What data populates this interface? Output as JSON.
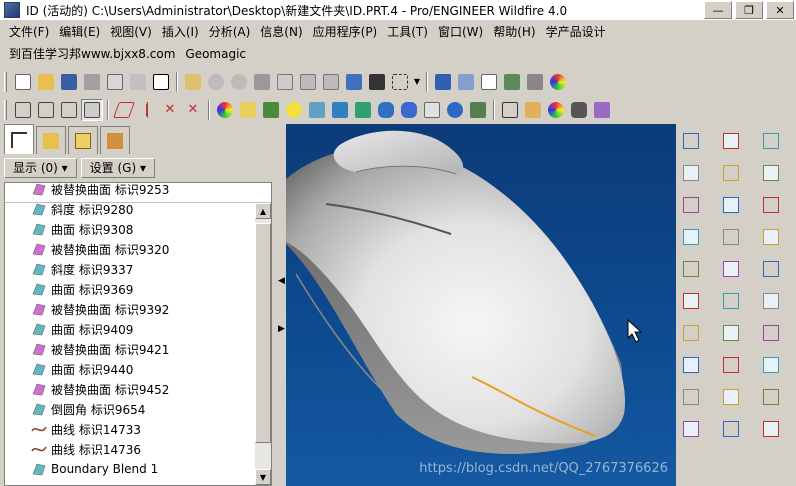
{
  "window": {
    "title": "ID (活动的) C:\\Users\\Administrator\\Desktop\\新建文件夹\\ID.PRT.4 - Pro/ENGINEER Wildfire 4.0",
    "minimize_glyph": "—",
    "maximize_glyph": "❐",
    "close_glyph": "✕"
  },
  "menubar": {
    "items": [
      "文件(F)",
      "编辑(E)",
      "视图(V)",
      "插入(I)",
      "分析(A)",
      "信息(N)",
      "应用程序(P)",
      "工具(T)",
      "窗口(W)",
      "帮助(H)",
      "学产品设计"
    ],
    "secondary": [
      "到百佳学习邦www.bjxx8.com",
      "Geomagic"
    ]
  },
  "toolbar1": {
    "icons": [
      "new-file-icon",
      "open-folder-icon",
      "save-icon",
      "print-icon",
      "email-icon",
      "regenerate-icon",
      "close-window-icon",
      "pen-icon",
      "undo-icon",
      "redo-icon",
      "cut-icon",
      "copy-icon",
      "paste-icon",
      "paste-special-icon",
      "regen-manager-icon",
      "binoculars-icon",
      "select-box-icon",
      "dropdown-arrow-icon",
      "orient-view-icon",
      "repaint-icon",
      "spin-center-icon",
      "layers-icon",
      "view-manager-icon",
      "color-palette-icon"
    ]
  },
  "toolbar2": {
    "icons": [
      "wireframe-icon",
      "hidden-line-icon",
      "no-hidden-icon",
      "shaded-icon",
      "shaded-edges-icon",
      "plane-display-icon",
      "axis-display-icon",
      "point-display-icon",
      "csys-display-icon",
      "appearance-icon",
      "model-tree-icon",
      "texture-icon",
      "light-bulb-icon",
      "spotlight-icon",
      "scene-icon",
      "render-icon",
      "teapot-icon",
      "surface-icon",
      "sphere-icon",
      "magnify-icon",
      "measure-icon",
      "distance-icon",
      "color-wheel-icon",
      "camera-icon",
      "analysis-icon"
    ]
  },
  "panel": {
    "tabs": [
      "model-tree-tab-icon",
      "folder-browser-tab-icon",
      "favorites-tab-icon",
      "connections-tab-icon"
    ],
    "show_label": "显示 (0) ▾",
    "settings_label": "设置 (G) ▾"
  },
  "tree": {
    "rows": [
      {
        "label": "被替换曲面 标识9253",
        "icon": "replaced-surface-icon",
        "color": "#c040c0"
      },
      {
        "label": "斜度 标识9280",
        "icon": "draft-icon",
        "color": "#30a0b0"
      },
      {
        "label": "曲面 标识9308",
        "icon": "surface-icon",
        "color": "#30a0b0"
      },
      {
        "label": "被替换曲面 标识9320",
        "icon": "replaced-surface-icon",
        "color": "#c040c0"
      },
      {
        "label": "斜度 标识9337",
        "icon": "draft-icon",
        "color": "#30a0b0"
      },
      {
        "label": "曲面 标识9369",
        "icon": "surface-icon",
        "color": "#30a0b0"
      },
      {
        "label": "被替换曲面 标识9392",
        "icon": "replaced-surface-icon",
        "color": "#c040c0"
      },
      {
        "label": "曲面 标识9409",
        "icon": "surface-icon",
        "color": "#30a0b0"
      },
      {
        "label": "被替换曲面 标识9421",
        "icon": "replaced-surface-icon",
        "color": "#c040c0"
      },
      {
        "label": "曲面 标识9440",
        "icon": "surface-icon",
        "color": "#30a0b0"
      },
      {
        "label": "被替换曲面 标识9452",
        "icon": "replaced-surface-icon",
        "color": "#c040c0"
      },
      {
        "label": "倒圆角 标识9654",
        "icon": "round-icon",
        "color": "#30a0b0"
      },
      {
        "label": "曲线 标识14733",
        "icon": "curve-icon",
        "color": "#804020"
      },
      {
        "label": "曲线 标识14736",
        "icon": "curve-icon",
        "color": "#804020"
      },
      {
        "label": "Boundary Blend 1",
        "icon": "boundary-blend-icon",
        "color": "#30a0b0"
      }
    ]
  },
  "viewport": {
    "watermark": "https://blog.csdn.net/QQ_2767376626"
  },
  "righttools": {
    "icons": [
      "datum-curve-sketch-icon",
      "plane-icon",
      "axis-icon",
      "curve-icon",
      "point-icon",
      "csys-icon",
      "analysis-icon",
      "chain-icon",
      "offset-icon",
      "extrude-icon",
      "revolve-icon",
      "sweep-icon",
      "blend-icon",
      "hole-icon",
      "round-icon",
      "draft-icon",
      "shell-icon",
      "rib-icon",
      "mirror-icon",
      "pattern-icon",
      "merge-icon",
      "trim-icon",
      "extend-icon",
      "thicken-icon",
      "solidify-icon",
      "warp-icon",
      "style-icon",
      "boundary-icon",
      "fill-icon",
      "intersect-icon"
    ]
  },
  "colors": {
    "titlebar_bg": "#ffffff",
    "chrome": "#d4d0c8",
    "viewport_top": "#0c3b78",
    "model_surface": "#d8d8d8",
    "curve": "#e8a020"
  }
}
